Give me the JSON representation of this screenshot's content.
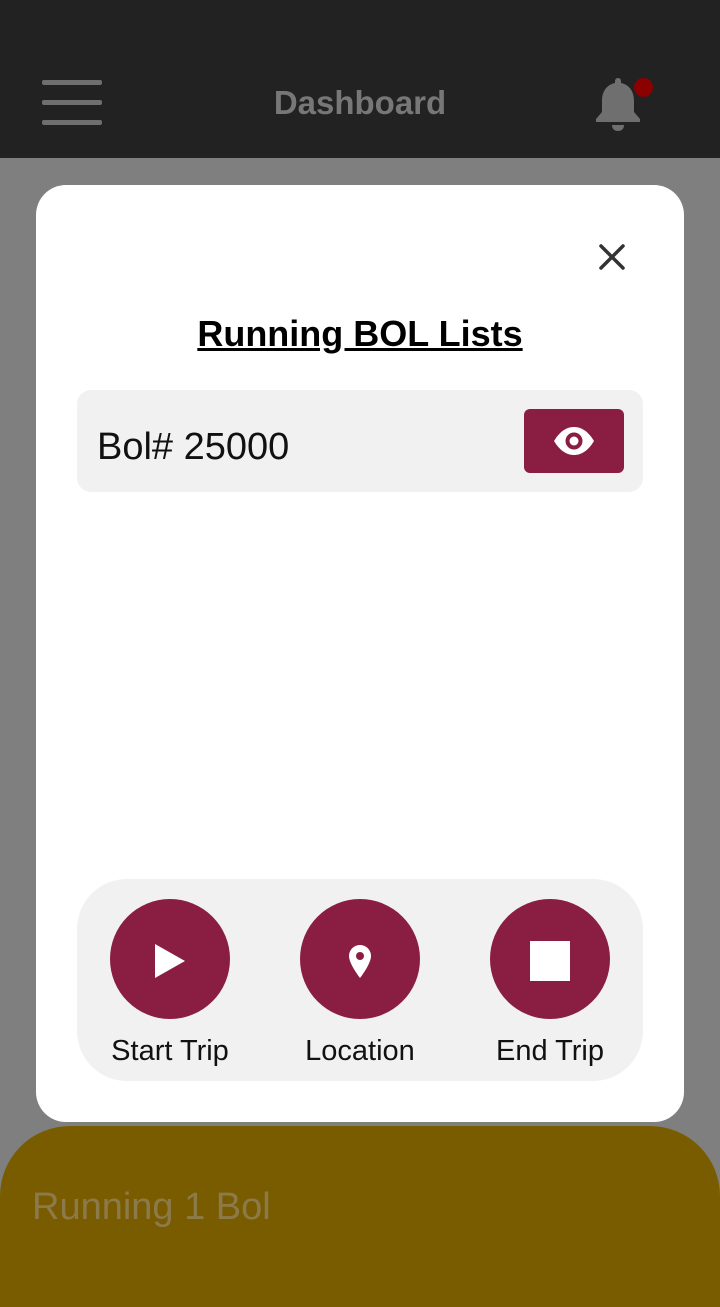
{
  "header": {
    "title": "Dashboard",
    "menu_icon": "hamburger-menu-icon",
    "bell_icon": "bell-icon",
    "notification_dot_color": "#8b0000"
  },
  "modal": {
    "title": "Running BOL Lists",
    "close_icon": "close-icon",
    "bol_items": [
      {
        "label": "Bol# 25000",
        "action_icon": "eye-icon"
      }
    ],
    "actions": [
      {
        "label": "Start Trip",
        "icon": "play-icon"
      },
      {
        "label": "Location",
        "icon": "map-pin-icon"
      },
      {
        "label": "End Trip",
        "icon": "stop-icon"
      }
    ],
    "accent_color": "#8a1e42"
  },
  "bottom_bar": {
    "label": "Running 1 Bol",
    "color": "#7a5c00"
  }
}
